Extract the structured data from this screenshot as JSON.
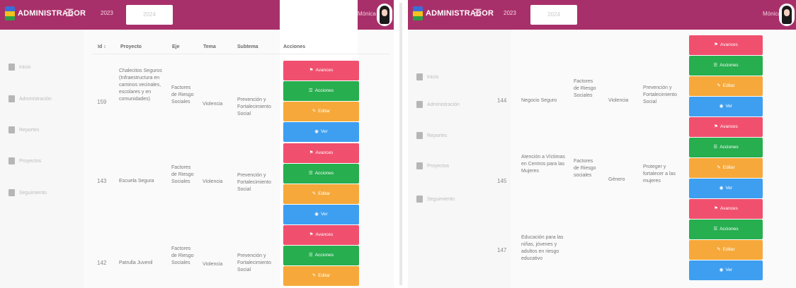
{
  "header": {
    "brand": "ADMINISTRADOR",
    "menu_icon": "hamburger-icon",
    "year_2023": "2023",
    "year_2024": "2024",
    "user_name": "Mónica",
    "color": "#a8306a"
  },
  "sidebar": {
    "items": [
      {
        "icon": "home-icon",
        "label": "Inicio"
      },
      {
        "icon": "grid-icon",
        "label": "Administración"
      },
      {
        "icon": "document-icon",
        "label": "Reportes"
      },
      {
        "icon": "building-icon",
        "label": "Proyectos"
      },
      {
        "icon": "list-icon",
        "label": "Seguimiento"
      }
    ]
  },
  "table": {
    "headers": [
      "Id",
      "Proyecto",
      "Eje",
      "Tema",
      "Subtema",
      "Acciones"
    ],
    "sort_icon": "sort-icon",
    "rows": [
      {
        "id": "159",
        "proyecto": "Chalecitos Seguros (Infraestructura en caminos vecinales, escolares y en comunidades)",
        "eje": "Factores de Riesgo Sociales",
        "tema": "Violencia",
        "subtema": "Prevención y Fortalecimiento Social"
      },
      {
        "id": "143",
        "proyecto": "Escuela Segura",
        "eje": "Factores de Riesgo Sociales",
        "tema": "Violencia",
        "subtema": "Prevención y Fortalecimiento Social"
      },
      {
        "id": "142",
        "proyecto": "Patrulla Juvenil",
        "eje": "Factores de Riesgo Sociales",
        "tema": "Violencia",
        "subtema": "Prevención y Fortalecimiento Social"
      }
    ],
    "rows_right": [
      {
        "id": "144",
        "proyecto": "Negocio Seguro",
        "eje": "Factores de Riesgo Sociales",
        "tema": "Violencia",
        "subtema": "Prevención y Fortalecimiento Social"
      },
      {
        "id": "145",
        "proyecto": "Atención a Víctimas en Centros para las Mujeres",
        "eje": "Factores de Riesgo sociales",
        "tema": "Género",
        "subtema": "Proteger y fortalecer a las mujeres"
      },
      {
        "id": "147",
        "proyecto": "Educación para las niñas, jóvenes y adultos en riesgo educativo",
        "eje": "",
        "tema": "",
        "subtema": ""
      }
    ],
    "actions": {
      "avances": "Avances",
      "acciones": "Acciones",
      "editar": "Editar",
      "ver": "Ver",
      "colors": {
        "avances": "#f0506e",
        "acciones": "#27ae4f",
        "editar": "#f6a93a",
        "ver": "#3e9ff0"
      }
    }
  }
}
